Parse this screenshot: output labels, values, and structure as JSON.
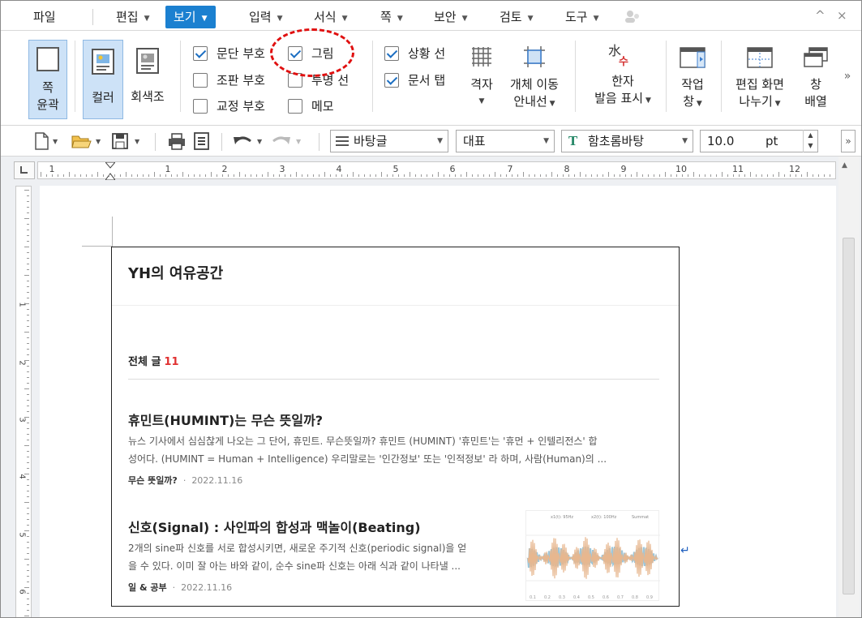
{
  "menu": {
    "items": [
      {
        "label": "파일",
        "has_arrow": false
      },
      {
        "label": "편집",
        "has_arrow": true
      },
      {
        "label": "보기",
        "has_arrow": true,
        "active": true
      },
      {
        "label": "입력",
        "has_arrow": true
      },
      {
        "label": "서식",
        "has_arrow": true
      },
      {
        "label": "쪽",
        "has_arrow": true
      },
      {
        "label": "보안",
        "has_arrow": true
      },
      {
        "label": "검토",
        "has_arrow": true
      },
      {
        "label": "도구",
        "has_arrow": true
      }
    ],
    "window_controls": [
      "^",
      "×"
    ]
  },
  "ribbon": {
    "page_outline": {
      "line1": "쪽",
      "line2": "윤곽"
    },
    "color": "컬러",
    "grayscale": "회색조",
    "checks_col1": [
      {
        "label": "문단 부호",
        "checked": true
      },
      {
        "label": "조판 부호",
        "checked": false
      },
      {
        "label": "교정 부호",
        "checked": false
      }
    ],
    "checks_col2": [
      {
        "label": "그림",
        "checked": true
      },
      {
        "label": "투명 선",
        "checked": false
      },
      {
        "label": "메모",
        "checked": false
      }
    ],
    "checks_col3": [
      {
        "label": "상황 선",
        "checked": true
      },
      {
        "label": "문서 탭",
        "checked": true
      }
    ],
    "grid": "격자",
    "object_move": {
      "line1": "개체 이동",
      "line2": "안내선"
    },
    "hanja": {
      "line1": "한자",
      "line2": "발음 표시"
    },
    "hanja_icon": {
      "top": "水",
      "bottom": "수"
    },
    "work_window": {
      "line1": "작업",
      "line2": "창"
    },
    "split": {
      "line1": "편집 화면",
      "line2": "나누기"
    },
    "window_arrange": {
      "line1": "창",
      "line2": "배열"
    },
    "more": "»"
  },
  "toolbar": {
    "style": "바탕글",
    "style_kind": "대표",
    "font": "함초롬바탕",
    "size": "10.0",
    "unit": "pt"
  },
  "ruler": {
    "h_numbers": [
      "1",
      "1",
      "2",
      "3",
      "4",
      "5",
      "6",
      "7",
      "8",
      "9",
      "10",
      "11",
      "12"
    ],
    "v_numbers": [
      "1",
      "2",
      "3",
      "4",
      "5",
      "6"
    ]
  },
  "blog": {
    "title": "YH의 여유공간",
    "total_label": "전체 글",
    "total_count": "11",
    "posts": [
      {
        "title": "휴민트(HUMINT)는 무슨 뜻일까?",
        "excerpt1": "뉴스 기사에서 심심찮게 나오는 그 단어, 휴민트. 무슨뜻일까? 휴민트 (HUMINT) '휴민트'는 '휴먼 + 인텔리전스' 합",
        "excerpt2": "성어다. (HUMINT = Human + Intelligence) 우리말로는 '인간정보' 또는 '인적정보' 라 하며, 사람(Human)의 ...",
        "category": "무슨 뜻일까?",
        "date": "2022.11.16"
      },
      {
        "title": "신호(Signal) : 사인파의 합성과 맥놀이(Beating)",
        "excerpt1": "2개의 sine파 신호를 서로 합성시키면, 새로운 주기적 신호(periodic signal)을 얻",
        "excerpt2": "을 수 있다. 이미 잘 아는 바와 같이, 순수 sine파 신호는 아래 식과 같이 나타낼 ...",
        "category": "일 & 공부",
        "date": "2022.11.16"
      }
    ],
    "thumb_legend": [
      "x1(t): 95Hz",
      "x2(t): 100Hz",
      "Summat"
    ],
    "thumb_axis": [
      "0.1",
      "0.2",
      "0.3",
      "0.4",
      "0.5",
      "0.6",
      "0.7",
      "0.8",
      "0.9"
    ]
  },
  "colors": {
    "accent": "#1b80d0",
    "annotation": "#e01010",
    "count": "#e03131"
  }
}
